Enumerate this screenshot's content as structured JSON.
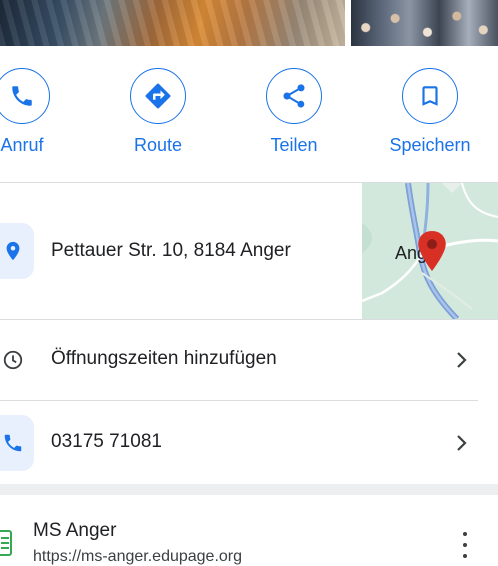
{
  "colors": {
    "accent": "#1a73e8",
    "chip_background": "#e8f0fe",
    "text": "#202124",
    "divider": "#dadce0",
    "map_pin": "#d93025"
  },
  "actions": [
    {
      "label": "Anruf",
      "icon": "phone-icon"
    },
    {
      "label": "Route",
      "icon": "directions-icon"
    },
    {
      "label": "Teilen",
      "icon": "share-icon"
    },
    {
      "label": "Speichern",
      "icon": "bookmark-icon"
    }
  ],
  "address": {
    "text": "Pettauer Str. 10, 8184 Anger",
    "icon": "location-pin-icon"
  },
  "map": {
    "place_label": "Anger"
  },
  "hours": {
    "text": "Öffnungszeiten hinzufügen",
    "icon": "clock-icon"
  },
  "phone": {
    "text": "03175 71081",
    "icon": "phone-icon"
  },
  "website": {
    "title": "MS Anger",
    "url": "https://ms-anger.edupage.org",
    "icon": "favicon-icon"
  }
}
